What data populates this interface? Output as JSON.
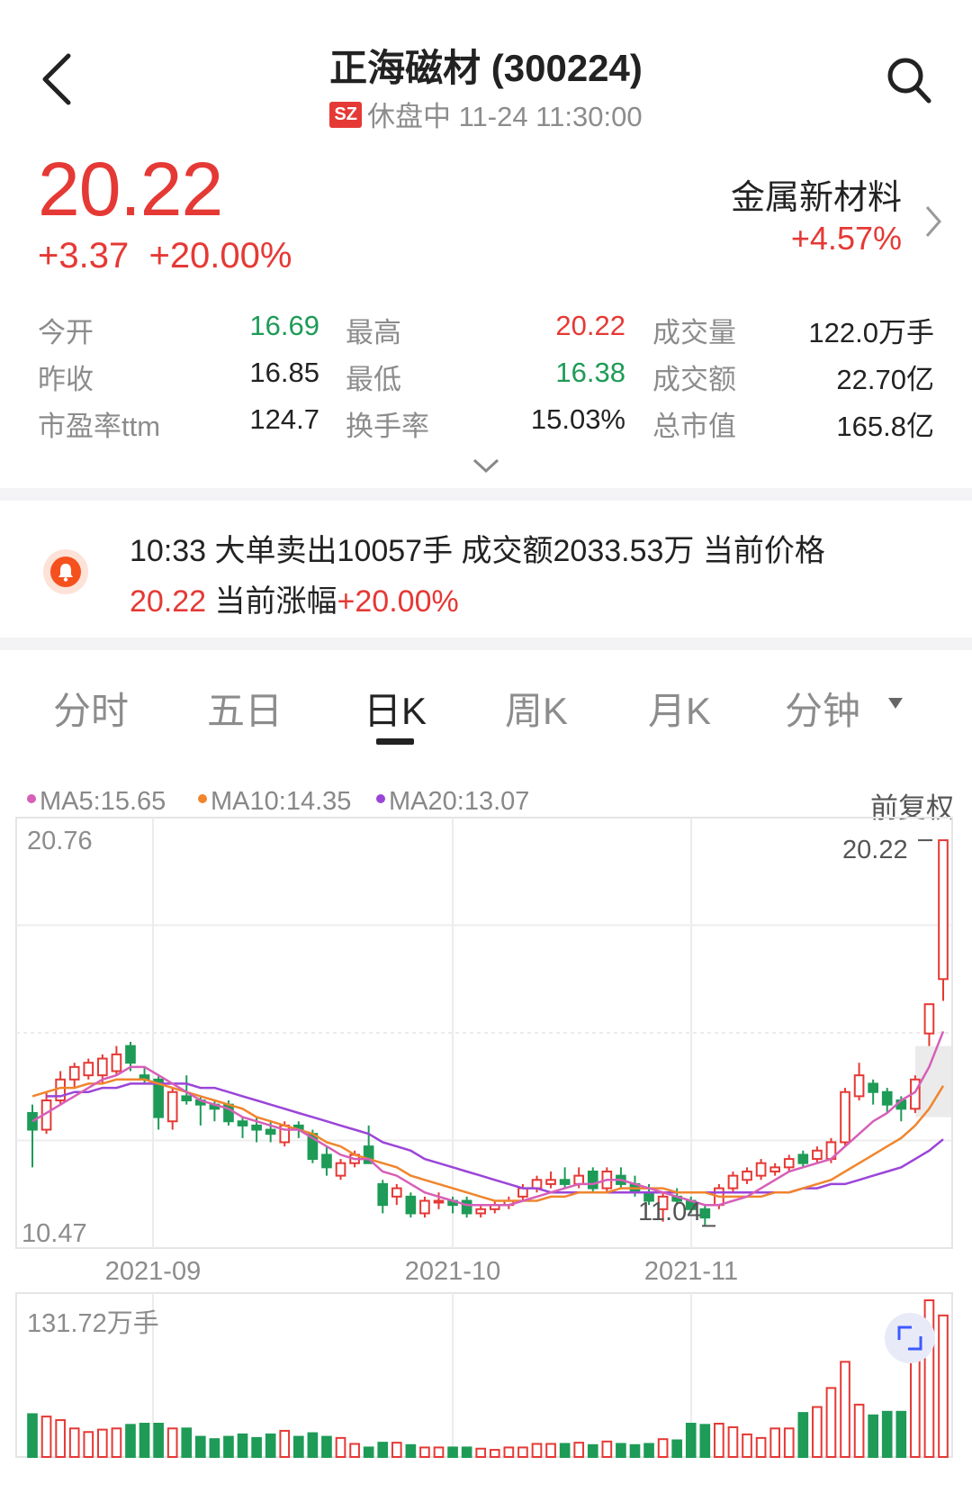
{
  "header": {
    "title": "正海磁材 (300224)",
    "exchange": "SZ",
    "status": "休盘中 11-24 11:30:00"
  },
  "quote": {
    "price": "20.22",
    "change": "+3.37",
    "change_pct": "+20.00%"
  },
  "sector": {
    "name": "金属新材料",
    "change_pct": "+4.57%"
  },
  "stats": [
    [
      {
        "label": "今开",
        "value": "16.69",
        "tone": "green"
      },
      {
        "label": "最高",
        "value": "20.22",
        "tone": "red"
      },
      {
        "label": "成交量",
        "value": "122.0万手",
        "tone": "plain"
      }
    ],
    [
      {
        "label": "昨收",
        "value": "16.85",
        "tone": "plain"
      },
      {
        "label": "最低",
        "value": "16.38",
        "tone": "green"
      },
      {
        "label": "成交额",
        "value": "22.70亿",
        "tone": "plain"
      }
    ],
    [
      {
        "label": "市盈率ttm",
        "value": "124.7",
        "tone": "plain"
      },
      {
        "label": "换手率",
        "value": "15.03%",
        "tone": "plain"
      },
      {
        "label": "总市值",
        "value": "165.8亿",
        "tone": "plain"
      }
    ]
  ],
  "alert": {
    "line1": "10:33 大单卖出10057手 成交额2033.53万 当前价格",
    "price": "20.22",
    "mid": " 当前涨幅",
    "pct": "+20.00%"
  },
  "tabs": [
    "分时",
    "五日",
    "日K",
    "周K",
    "月K",
    "分钟"
  ],
  "active_tab": "日K",
  "legend": {
    "ma5": "MA5:15.65",
    "ma10": "MA10:14.35",
    "ma20": "MA20:13.07",
    "adjust": "前复权"
  },
  "colors": {
    "up": "#e53935",
    "down": "#1e9b57",
    "ma5": "#d65fb8",
    "ma10": "#f0852d",
    "ma20": "#9b45d8"
  },
  "chart_data": {
    "type": "candlestick",
    "y_top_label": "20.76",
    "y_bottom_label": "10.47",
    "ylim": [
      10.47,
      20.76
    ],
    "x_tick_labels": [
      "2021-09",
      "2021-10",
      "2021-11"
    ],
    "max_label": "20.22",
    "min_label": "11.04",
    "volume_max_label": "131.72万手",
    "candles": [
      {
        "o": 13.7,
        "h": 13.9,
        "l": 12.4,
        "c": 13.3
      },
      {
        "o": 13.3,
        "h": 14.2,
        "l": 13.2,
        "c": 14.0
      },
      {
        "o": 14.0,
        "h": 14.7,
        "l": 13.9,
        "c": 14.5
      },
      {
        "o": 14.5,
        "h": 14.9,
        "l": 14.3,
        "c": 14.8
      },
      {
        "o": 14.6,
        "h": 15.0,
        "l": 14.5,
        "c": 14.9
      },
      {
        "o": 14.6,
        "h": 15.1,
        "l": 14.4,
        "c": 15.0
      },
      {
        "o": 14.7,
        "h": 15.3,
        "l": 14.6,
        "c": 15.1
      },
      {
        "o": 15.3,
        "h": 15.4,
        "l": 14.7,
        "c": 14.9
      },
      {
        "o": 14.6,
        "h": 14.8,
        "l": 14.4,
        "c": 14.5
      },
      {
        "o": 14.5,
        "h": 14.6,
        "l": 13.3,
        "c": 13.6
      },
      {
        "o": 13.5,
        "h": 14.3,
        "l": 13.3,
        "c": 14.2
      },
      {
        "o": 14.1,
        "h": 14.6,
        "l": 13.9,
        "c": 14.0
      },
      {
        "o": 14.0,
        "h": 14.1,
        "l": 13.4,
        "c": 13.9
      },
      {
        "o": 13.9,
        "h": 14.0,
        "l": 13.5,
        "c": 13.8
      },
      {
        "o": 13.9,
        "h": 14.0,
        "l": 13.4,
        "c": 13.5
      },
      {
        "o": 13.5,
        "h": 13.6,
        "l": 13.1,
        "c": 13.4
      },
      {
        "o": 13.4,
        "h": 13.6,
        "l": 13.0,
        "c": 13.3
      },
      {
        "o": 13.3,
        "h": 13.5,
        "l": 13.0,
        "c": 13.2
      },
      {
        "o": 13.0,
        "h": 13.5,
        "l": 12.9,
        "c": 13.4
      },
      {
        "o": 13.4,
        "h": 13.5,
        "l": 13.1,
        "c": 13.3
      },
      {
        "o": 13.2,
        "h": 13.3,
        "l": 12.5,
        "c": 12.6
      },
      {
        "o": 12.7,
        "h": 12.9,
        "l": 12.2,
        "c": 12.4
      },
      {
        "o": 12.2,
        "h": 12.6,
        "l": 12.1,
        "c": 12.5
      },
      {
        "o": 12.5,
        "h": 12.8,
        "l": 12.4,
        "c": 12.7
      },
      {
        "o": 12.9,
        "h": 13.4,
        "l": 12.5,
        "c": 12.5
      },
      {
        "o": 12.0,
        "h": 12.1,
        "l": 11.3,
        "c": 11.5
      },
      {
        "o": 11.7,
        "h": 12.0,
        "l": 11.5,
        "c": 11.9
      },
      {
        "o": 11.7,
        "h": 11.8,
        "l": 11.2,
        "c": 11.3
      },
      {
        "o": 11.3,
        "h": 11.7,
        "l": 11.2,
        "c": 11.6
      },
      {
        "o": 11.6,
        "h": 11.8,
        "l": 11.4,
        "c": 11.6
      },
      {
        "o": 11.6,
        "h": 11.7,
        "l": 11.3,
        "c": 11.5
      },
      {
        "o": 11.6,
        "h": 11.7,
        "l": 11.2,
        "c": 11.3
      },
      {
        "o": 11.3,
        "h": 11.5,
        "l": 11.2,
        "c": 11.4
      },
      {
        "o": 11.4,
        "h": 11.6,
        "l": 11.3,
        "c": 11.5
      },
      {
        "o": 11.5,
        "h": 11.7,
        "l": 11.4,
        "c": 11.6
      },
      {
        "o": 11.7,
        "h": 12.0,
        "l": 11.6,
        "c": 11.9
      },
      {
        "o": 11.9,
        "h": 12.2,
        "l": 11.8,
        "c": 12.1
      },
      {
        "o": 12.0,
        "h": 12.3,
        "l": 11.9,
        "c": 12.1
      },
      {
        "o": 12.1,
        "h": 12.4,
        "l": 11.9,
        "c": 12.0
      },
      {
        "o": 12.0,
        "h": 12.4,
        "l": 11.9,
        "c": 12.2
      },
      {
        "o": 12.3,
        "h": 12.4,
        "l": 11.8,
        "c": 11.9
      },
      {
        "o": 11.9,
        "h": 12.4,
        "l": 11.8,
        "c": 12.3
      },
      {
        "o": 12.2,
        "h": 12.4,
        "l": 11.9,
        "c": 12.0
      },
      {
        "o": 12.0,
        "h": 12.2,
        "l": 11.7,
        "c": 11.8
      },
      {
        "o": 11.8,
        "h": 12.0,
        "l": 11.5,
        "c": 11.6
      },
      {
        "o": 11.4,
        "h": 11.8,
        "l": 11.1,
        "c": 11.7
      },
      {
        "o": 11.7,
        "h": 11.9,
        "l": 11.5,
        "c": 11.6
      },
      {
        "o": 11.6,
        "h": 11.7,
        "l": 11.3,
        "c": 11.4
      },
      {
        "o": 11.4,
        "h": 11.5,
        "l": 11.0,
        "c": 11.2
      },
      {
        "o": 11.5,
        "h": 12.0,
        "l": 11.4,
        "c": 11.9
      },
      {
        "o": 11.9,
        "h": 12.3,
        "l": 11.8,
        "c": 12.2
      },
      {
        "o": 12.1,
        "h": 12.4,
        "l": 12.0,
        "c": 12.3
      },
      {
        "o": 12.2,
        "h": 12.6,
        "l": 12.1,
        "c": 12.5
      },
      {
        "o": 12.3,
        "h": 12.5,
        "l": 12.2,
        "c": 12.4
      },
      {
        "o": 12.4,
        "h": 12.7,
        "l": 12.3,
        "c": 12.6
      },
      {
        "o": 12.7,
        "h": 12.8,
        "l": 12.4,
        "c": 12.5
      },
      {
        "o": 12.6,
        "h": 12.9,
        "l": 12.5,
        "c": 12.8
      },
      {
        "o": 12.6,
        "h": 13.1,
        "l": 12.5,
        "c": 13.0
      },
      {
        "o": 13.0,
        "h": 14.3,
        "l": 12.9,
        "c": 14.2
      },
      {
        "o": 14.1,
        "h": 14.9,
        "l": 14.0,
        "c": 14.6
      },
      {
        "o": 14.4,
        "h": 14.5,
        "l": 13.9,
        "c": 14.2
      },
      {
        "o": 14.2,
        "h": 14.3,
        "l": 13.7,
        "c": 13.9
      },
      {
        "o": 14.0,
        "h": 14.1,
        "l": 13.5,
        "c": 13.8
      },
      {
        "o": 13.8,
        "h": 14.6,
        "l": 13.7,
        "c": 14.5
      },
      {
        "o": 15.6,
        "h": 16.3,
        "l": 15.3,
        "c": 16.3
      },
      {
        "o": 16.9,
        "h": 20.22,
        "l": 16.38,
        "c": 20.22
      }
    ],
    "ma5": [
      13.5,
      13.7,
      13.9,
      14.1,
      14.3,
      14.5,
      14.6,
      14.8,
      14.8,
      14.6,
      14.4,
      14.2,
      14.0,
      13.9,
      13.8,
      13.6,
      13.5,
      13.4,
      13.3,
      13.3,
      13.1,
      12.9,
      12.7,
      12.6,
      12.6,
      12.3,
      12.2,
      12.0,
      11.8,
      11.7,
      11.6,
      11.5,
      11.5,
      11.5,
      11.5,
      11.6,
      11.7,
      11.8,
      11.9,
      12.0,
      12.0,
      12.1,
      12.1,
      12.0,
      11.9,
      11.8,
      11.7,
      11.6,
      11.5,
      11.5,
      11.6,
      11.7,
      11.9,
      12.1,
      12.3,
      12.4,
      12.5,
      12.6,
      12.9,
      13.2,
      13.5,
      13.7,
      14.0,
      14.2,
      14.8,
      15.65
    ],
    "ma10": [
      14.1,
      14.2,
      14.3,
      14.3,
      14.4,
      14.4,
      14.5,
      14.5,
      14.5,
      14.4,
      14.3,
      14.2,
      14.1,
      14.0,
      13.9,
      13.8,
      13.6,
      13.5,
      13.4,
      13.3,
      13.2,
      13.0,
      12.9,
      12.7,
      12.6,
      12.5,
      12.4,
      12.2,
      12.1,
      12.0,
      11.9,
      11.8,
      11.7,
      11.6,
      11.6,
      11.6,
      11.6,
      11.7,
      11.7,
      11.8,
      11.8,
      11.8,
      11.9,
      11.9,
      11.9,
      11.9,
      11.8,
      11.8,
      11.8,
      11.7,
      11.7,
      11.7,
      11.7,
      11.8,
      11.8,
      11.9,
      12.0,
      12.1,
      12.3,
      12.5,
      12.7,
      12.9,
      13.1,
      13.4,
      13.8,
      14.35
    ],
    "ma20": [
      14.1,
      14.1,
      14.2,
      14.2,
      14.3,
      14.3,
      14.4,
      14.4,
      14.4,
      14.4,
      14.4,
      14.3,
      14.3,
      14.2,
      14.1,
      14.0,
      13.9,
      13.8,
      13.7,
      13.6,
      13.5,
      13.4,
      13.3,
      13.2,
      13.0,
      12.9,
      12.8,
      12.6,
      12.5,
      12.4,
      12.3,
      12.2,
      12.1,
      12.0,
      11.9,
      11.9,
      11.8,
      11.8,
      11.8,
      11.8,
      11.8,
      11.8,
      11.8,
      11.8,
      11.8,
      11.8,
      11.8,
      11.8,
      11.8,
      11.8,
      11.8,
      11.8,
      11.8,
      11.8,
      11.9,
      11.9,
      12.0,
      12.0,
      12.1,
      12.2,
      12.3,
      12.4,
      12.6,
      12.8,
      13.07
    ],
    "volumes": [
      36,
      34,
      31,
      24,
      21,
      23,
      24,
      27,
      28,
      28,
      24,
      24,
      17,
      15,
      17,
      19,
      16,
      19,
      22,
      17,
      20,
      17,
      16,
      11,
      8,
      12,
      12,
      10,
      8,
      8,
      8,
      8,
      7,
      6,
      8,
      8,
      11,
      11,
      11,
      12,
      10,
      13,
      11,
      10,
      11,
      15,
      14,
      28,
      27,
      28,
      25,
      19,
      16,
      24,
      24,
      37,
      42,
      58,
      80,
      44,
      35,
      38,
      38,
      114,
      131.72,
      119
    ]
  }
}
